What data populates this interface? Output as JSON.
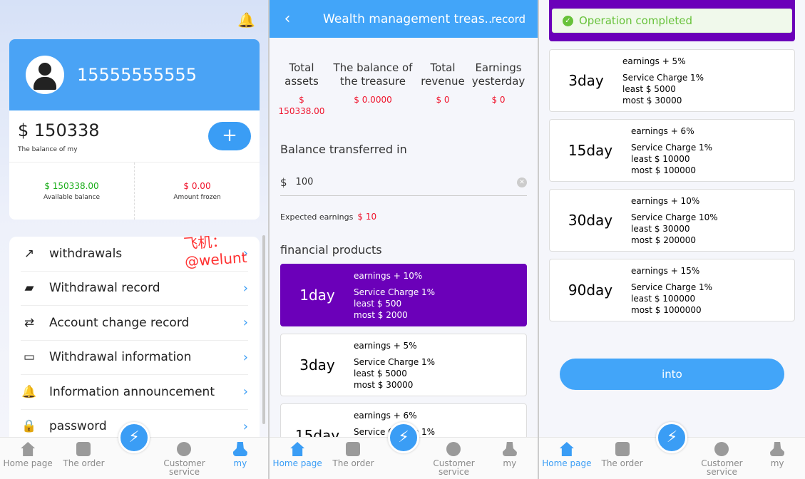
{
  "watermark": "飞机：@welunt",
  "tabs": [
    {
      "label": "Home page",
      "icon": "home-icon"
    },
    {
      "label": "The order",
      "icon": "order-icon"
    },
    {
      "label": "Customer service",
      "icon": "chat-icon"
    },
    {
      "label": "my",
      "icon": "user-icon"
    }
  ],
  "accent": "#42a5f9",
  "my": {
    "phone": "15555555555",
    "balance": "$ 150338",
    "balance_label": "The balance of my",
    "available": "$ 150338.00",
    "available_label": "Available balance",
    "frozen": "$ 0.00",
    "frozen_label": "Amount frozen",
    "menu": [
      {
        "label": "withdrawals",
        "icon": "arrow-icon"
      },
      {
        "label": "Withdrawal record",
        "icon": "wallet-icon"
      },
      {
        "label": "Account change record",
        "icon": "exchange-icon"
      },
      {
        "label": "Withdrawal information",
        "icon": "card-icon"
      },
      {
        "label": "Information announcement",
        "icon": "bell-icon"
      },
      {
        "label": "password",
        "icon": "lock-icon"
      }
    ]
  },
  "treasure": {
    "title": "Wealth management treas...",
    "record": "record",
    "stats": [
      {
        "label": "Total assets",
        "value": "$ 150338.00"
      },
      {
        "label": "The balance of the treasure",
        "value": "$ 0.0000"
      },
      {
        "label": "Total revenue",
        "value": "$ 0"
      },
      {
        "label": "Earnings yesterday",
        "value": "$ 0"
      }
    ],
    "transfer_label": "Balance transferred in",
    "currency": "$",
    "amount": "100",
    "expected_label": "Expected earnings",
    "expected_value": "$ 10",
    "products_label": "financial products"
  },
  "products": [
    {
      "day": "1day",
      "earnings": "earnings + 10%",
      "charge": "Service Charge 1%",
      "least": "least $ 500",
      "most": "most $ 2000"
    },
    {
      "day": "3day",
      "earnings": "earnings + 5%",
      "charge": "Service Charge 1%",
      "least": "least $ 5000",
      "most": "most $ 30000"
    },
    {
      "day": "15day",
      "earnings": "earnings + 6%",
      "charge": "Service Charge 1%",
      "least": "least $ 10000",
      "most": "most $ 100000"
    },
    {
      "day": "30day",
      "earnings": "earnings + 10%",
      "charge": "Service Charge 10%",
      "least": "least $ 30000",
      "most": "most $ 200000"
    },
    {
      "day": "90day",
      "earnings": "earnings + 15%",
      "charge": "Service Charge 1%",
      "least": "least $ 100000",
      "most": "most $ 1000000"
    }
  ],
  "toast": "Operation completed",
  "into": "into"
}
